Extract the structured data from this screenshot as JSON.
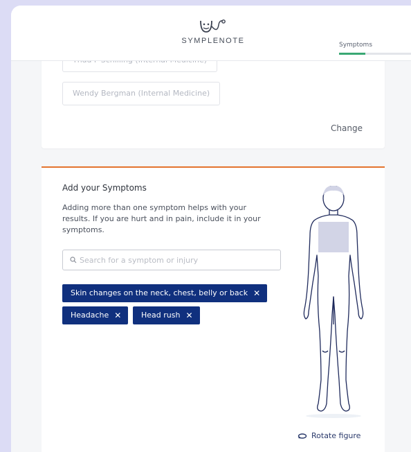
{
  "header": {
    "logo_text": "SYMPLENOTE",
    "step_label": "Symptoms",
    "step_progress_fraction": 0.37
  },
  "providers": {
    "items": [
      "Thad F Schilling (Internal Medicine)",
      "Wendy Bergman (Internal Medicine)"
    ],
    "change_label": "Change"
  },
  "symptoms": {
    "title": "Add your Symptoms",
    "description": "Adding more than one symptom helps with your results. If you are hurt and in pain, include it in your symptoms.",
    "search_placeholder": "Search for a symptom or injury",
    "chips": [
      "Skin changes on the neck, chest, belly or back",
      "Headache",
      "Head rush"
    ],
    "chip_remove_glyph": "✕",
    "rotate_label": "Rotate figure"
  },
  "colors": {
    "accent_orange": "#e3732d",
    "chip_navy": "#10307e",
    "progress_green": "#3aa874",
    "highlight_region": "#d2d4e6"
  },
  "icons": {
    "logo": "stethoscope-smile-icon",
    "search": "search-icon",
    "rotate": "rotate-icon",
    "remove": "close-icon"
  }
}
